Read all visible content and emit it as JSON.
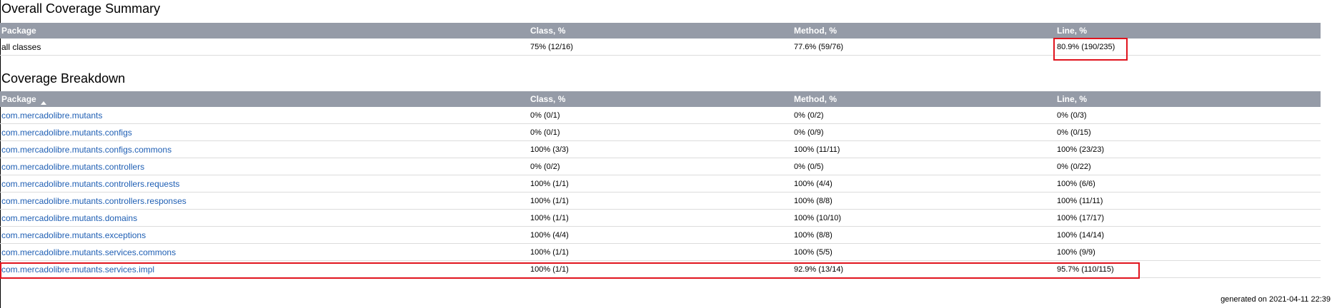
{
  "summary": {
    "title": "Overall Coverage Summary",
    "headers": [
      "Package",
      "Class, %",
      "Method, %",
      "Line, %"
    ],
    "row": {
      "package": "all classes",
      "class_pct": "75% (12/16)",
      "method_pct": "77.6% (59/76)",
      "line_pct": "80.9% (190/235)"
    }
  },
  "breakdown": {
    "title": "Coverage Breakdown",
    "headers": [
      "Package",
      "Class, %",
      "Method, %",
      "Line, %"
    ],
    "sort_indicator": "ascending",
    "rows": [
      {
        "package": "com.mercadolibre.mutants",
        "class_pct": "0% (0/1)",
        "method_pct": "0% (0/2)",
        "line_pct": "0% (0/3)"
      },
      {
        "package": "com.mercadolibre.mutants.configs",
        "class_pct": "0% (0/1)",
        "method_pct": "0% (0/9)",
        "line_pct": "0% (0/15)"
      },
      {
        "package": "com.mercadolibre.mutants.configs.commons",
        "class_pct": "100% (3/3)",
        "method_pct": "100% (11/11)",
        "line_pct": "100% (23/23)"
      },
      {
        "package": "com.mercadolibre.mutants.controllers",
        "class_pct": "0% (0/2)",
        "method_pct": "0% (0/5)",
        "line_pct": "0% (0/22)"
      },
      {
        "package": "com.mercadolibre.mutants.controllers.requests",
        "class_pct": "100% (1/1)",
        "method_pct": "100% (4/4)",
        "line_pct": "100% (6/6)"
      },
      {
        "package": "com.mercadolibre.mutants.controllers.responses",
        "class_pct": "100% (1/1)",
        "method_pct": "100% (8/8)",
        "line_pct": "100% (11/11)"
      },
      {
        "package": "com.mercadolibre.mutants.domains",
        "class_pct": "100% (1/1)",
        "method_pct": "100% (10/10)",
        "line_pct": "100% (17/17)"
      },
      {
        "package": "com.mercadolibre.mutants.exceptions",
        "class_pct": "100% (4/4)",
        "method_pct": "100% (8/8)",
        "line_pct": "100% (14/14)"
      },
      {
        "package": "com.mercadolibre.mutants.services.commons",
        "class_pct": "100% (1/1)",
        "method_pct": "100% (5/5)",
        "line_pct": "100% (9/9)"
      },
      {
        "package": "com.mercadolibre.mutants.services.impl",
        "class_pct": "100% (1/1)",
        "method_pct": "92.9% (13/14)",
        "line_pct": "95.7% (110/115)"
      }
    ]
  },
  "footer": {
    "generated": "generated on 2021-04-11 22:39"
  },
  "colors": {
    "header_bg": "#959ba7",
    "link": "#1f5fb4",
    "highlight": "#e0141e",
    "row_divider": "#dcdcdc"
  }
}
